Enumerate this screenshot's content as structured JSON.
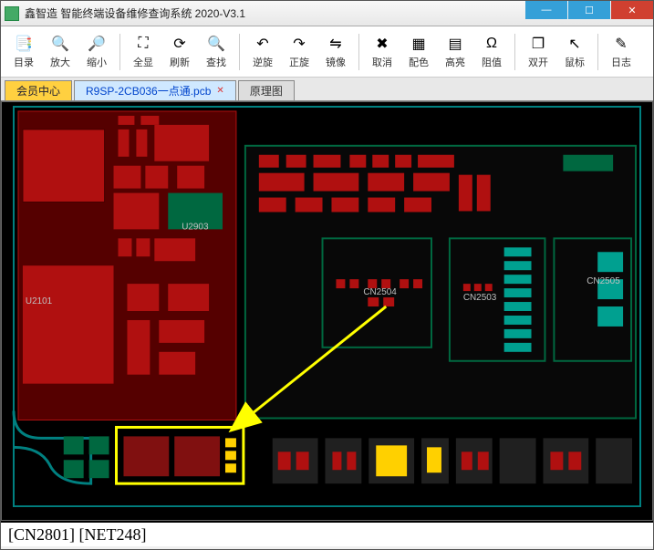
{
  "window": {
    "title": "鑫智造 智能终端设备维修查询系统 2020-V3.1"
  },
  "toolbar": {
    "items": [
      {
        "label": "目录",
        "icon": "📑"
      },
      {
        "label": "放大",
        "icon": "🔍"
      },
      {
        "label": "缩小",
        "icon": "🔎"
      },
      {
        "sep": true
      },
      {
        "label": "全显",
        "icon": "⛶"
      },
      {
        "label": "刷新",
        "icon": "⟳"
      },
      {
        "label": "查找",
        "icon": "🔍"
      },
      {
        "sep": true
      },
      {
        "label": "逆旋",
        "icon": "↶"
      },
      {
        "label": "正旋",
        "icon": "↷"
      },
      {
        "label": "镜像",
        "icon": "⇋"
      },
      {
        "sep": true
      },
      {
        "label": "取消",
        "icon": "✖"
      },
      {
        "label": "配色",
        "icon": "▦"
      },
      {
        "label": "高亮",
        "icon": "▤"
      },
      {
        "label": "阻值",
        "icon": "Ω"
      },
      {
        "sep": true
      },
      {
        "label": "双开",
        "icon": "❐"
      },
      {
        "label": "鼠标",
        "icon": "↖"
      },
      {
        "sep": true
      },
      {
        "label": "日志",
        "icon": "✎"
      }
    ]
  },
  "tabs": {
    "member": "会员中心",
    "active": "R9SP-2CB036一点通.pcb",
    "schematic": "原理图"
  },
  "pcb": {
    "refs": {
      "u2101": "U2101",
      "u2903": "U2903",
      "cn2504": "CN2504",
      "cn2503": "CN2503",
      "cn2505": "CN2505"
    }
  },
  "status": {
    "text": "[CN2801] [NET248]"
  },
  "colors": {
    "pcb_bg": "#000000",
    "outline": "#008080",
    "copper": "#b01010",
    "copper2": "#801010",
    "silkgreen": "#006840",
    "teal": "#00a090",
    "yellow": "#ffd000",
    "arrow": "#ffff00"
  }
}
